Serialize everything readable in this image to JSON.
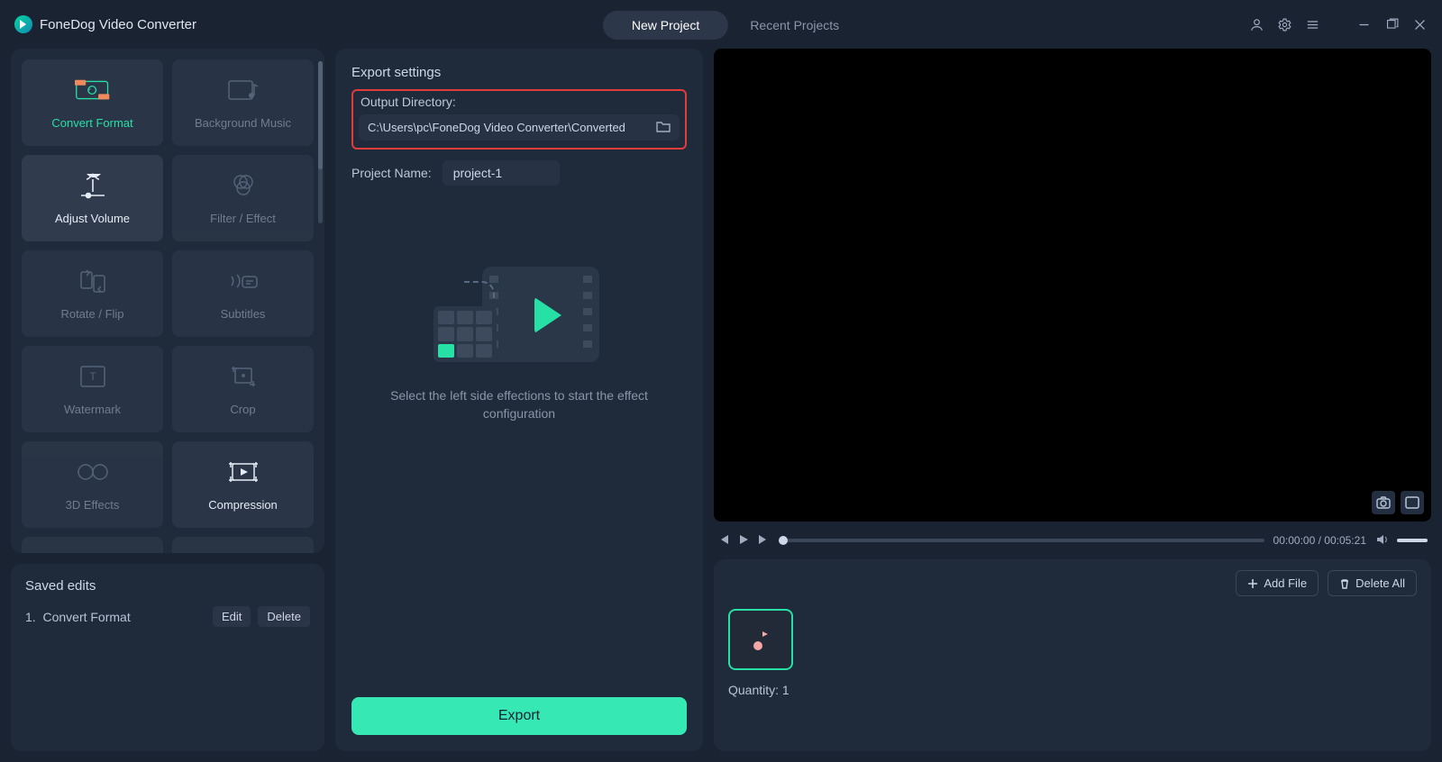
{
  "app_title": "FoneDog Video Converter",
  "tabs": {
    "new_project": "New Project",
    "recent_projects": "Recent Projects"
  },
  "effects": {
    "convert_format": "Convert Format",
    "background_music": "Background Music",
    "adjust_volume": "Adjust Volume",
    "filter_effect": "Filter / Effect",
    "rotate_flip": "Rotate / Flip",
    "subtitles": "Subtitles",
    "watermark": "Watermark",
    "crop": "Crop",
    "three_d": "3D Effects",
    "compression": "Compression"
  },
  "saved_edits": {
    "title": "Saved edits",
    "items": [
      {
        "index": "1.",
        "label": "Convert Format"
      }
    ],
    "edit": "Edit",
    "delete": "Delete"
  },
  "export_settings": {
    "title": "Export settings",
    "output_dir_label": "Output Directory:",
    "output_dir_value": "C:\\Users\\pc\\FoneDog Video Converter\\Converted",
    "project_name_label": "Project Name:",
    "project_name_value": "project-1",
    "placeholder_text": "Select the left side effections to start the effect configuration",
    "export_btn": "Export"
  },
  "playback": {
    "current": "00:00:00",
    "total": "00:05:21"
  },
  "files": {
    "add_file": "Add File",
    "delete_all": "Delete All",
    "quantity_label": "Quantity:",
    "quantity_value": "1"
  }
}
